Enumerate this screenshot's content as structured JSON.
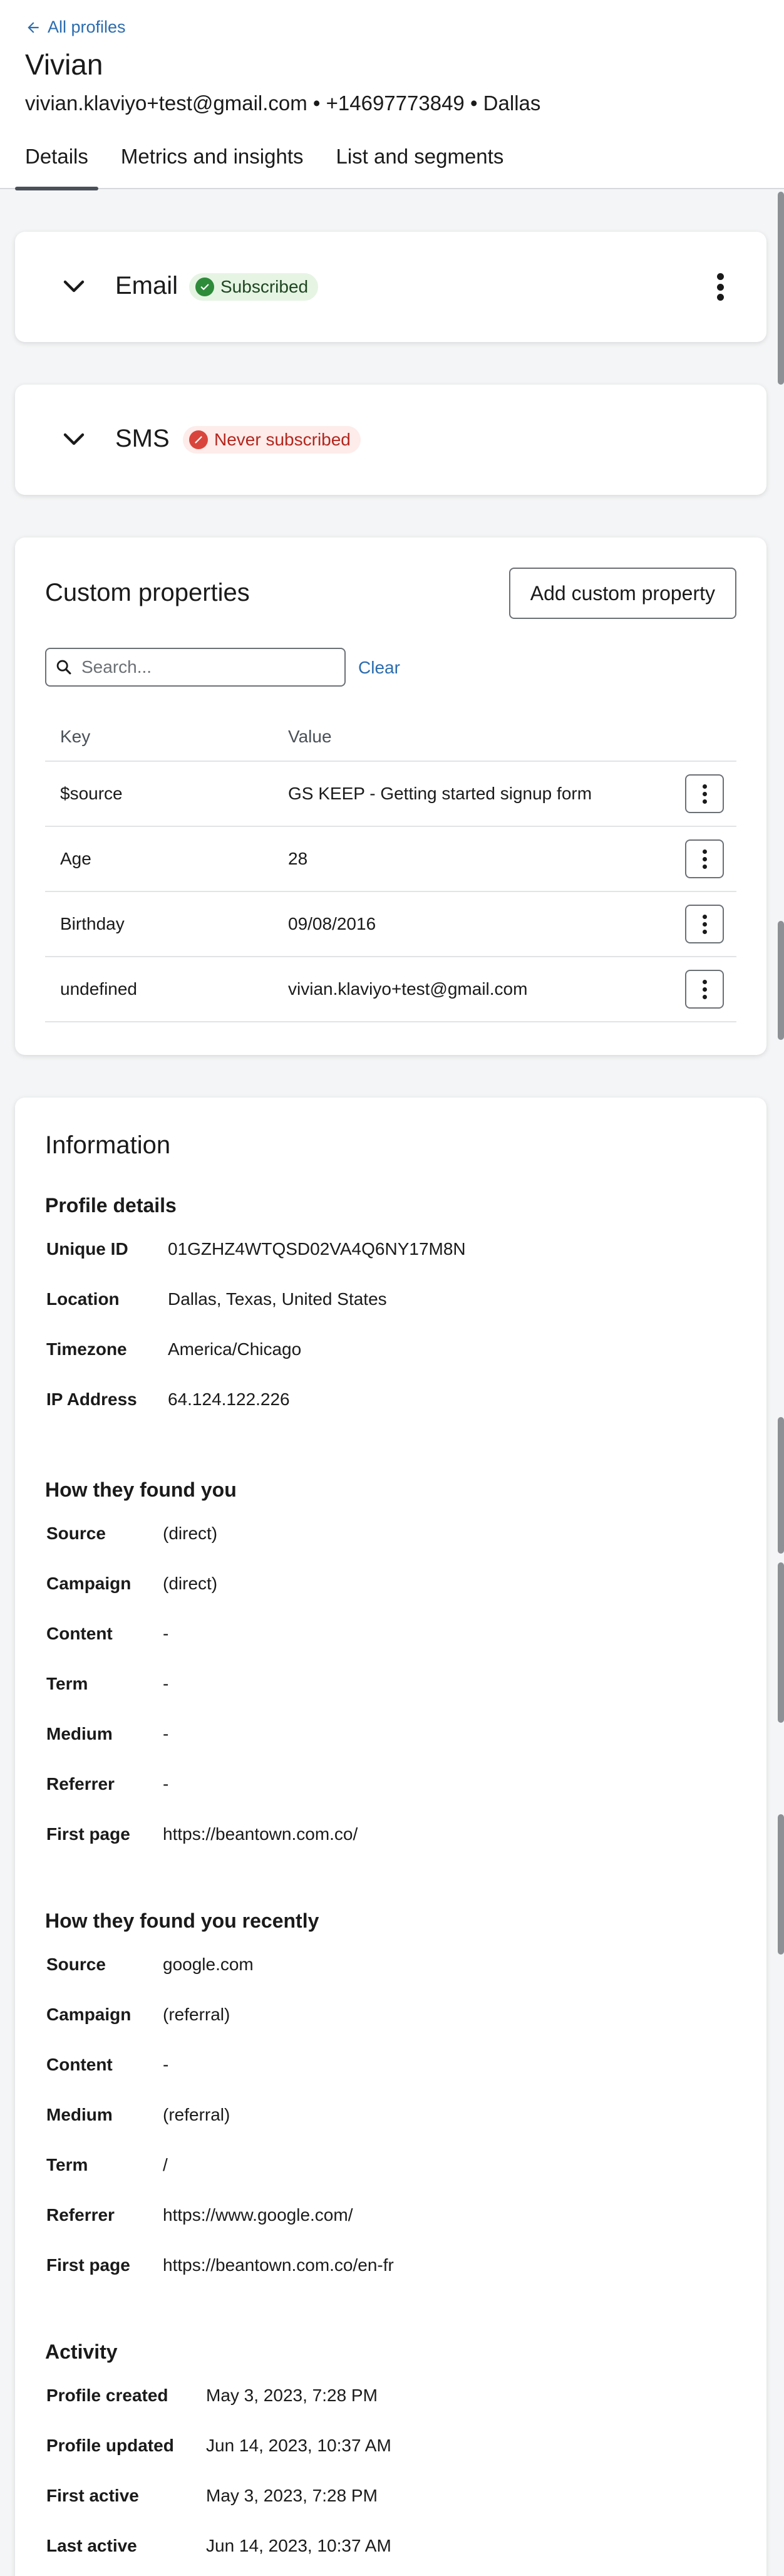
{
  "header": {
    "back_label": "All profiles",
    "name": "Vivian",
    "meta": "vivian.klaviyo+test@gmail.com • +14697773849 • Dallas",
    "tabs": [
      {
        "label": "Details",
        "active": true
      },
      {
        "label": "Metrics and insights",
        "active": false
      },
      {
        "label": "List and segments",
        "active": false
      }
    ]
  },
  "email_card": {
    "title": "Email",
    "status": "Subscribed",
    "status_color": "#2e8b3a"
  },
  "sms_card": {
    "title": "SMS",
    "status": "Never subscribed",
    "status_color": "#d9453c"
  },
  "custom_properties": {
    "title": "Custom properties",
    "add_button": "Add custom property",
    "search_placeholder": "Search...",
    "clear_label": "Clear",
    "columns": {
      "key": "Key",
      "value": "Value"
    },
    "rows": [
      {
        "key": "$source",
        "value": "GS KEEP - Getting started signup form"
      },
      {
        "key": "Age",
        "value": "28"
      },
      {
        "key": "Birthday",
        "value": "09/08/2016"
      },
      {
        "key": "undefined",
        "value": "vivian.klaviyo+test@gmail.com"
      }
    ]
  },
  "information": {
    "title": "Information",
    "profile_details": {
      "heading": "Profile details",
      "items": [
        {
          "label": "Unique ID",
          "value": "01GZHZ4WTQSD02VA4Q6NY17M8N"
        },
        {
          "label": "Location",
          "value": "Dallas, Texas, United States"
        },
        {
          "label": "Timezone",
          "value": "America/Chicago"
        },
        {
          "label": "IP Address",
          "value": "64.124.122.226"
        }
      ]
    },
    "found_you": {
      "heading": "How they found you",
      "items": [
        {
          "label": "Source",
          "value": "(direct)"
        },
        {
          "label": "Campaign",
          "value": "(direct)"
        },
        {
          "label": "Content",
          "value": "-"
        },
        {
          "label": "Term",
          "value": "-"
        },
        {
          "label": "Medium",
          "value": "-"
        },
        {
          "label": "Referrer",
          "value": "-"
        },
        {
          "label": "First page",
          "value": "https://beantown.com.co/"
        }
      ]
    },
    "found_you_recently": {
      "heading": "How they found you recently",
      "items": [
        {
          "label": "Source",
          "value": "google.com"
        },
        {
          "label": "Campaign",
          "value": "(referral)"
        },
        {
          "label": "Content",
          "value": "-"
        },
        {
          "label": "Medium",
          "value": "(referral)"
        },
        {
          "label": "Term",
          "value": "/"
        },
        {
          "label": "Referrer",
          "value": "https://www.google.com/"
        },
        {
          "label": "First page",
          "value": "https://beantown.com.co/en-fr"
        }
      ]
    },
    "activity": {
      "heading": "Activity",
      "items": [
        {
          "label": "Profile created",
          "value": "May 3, 2023, 7:28 PM"
        },
        {
          "label": "Profile updated",
          "value": "Jun 14, 2023, 10:37 AM"
        },
        {
          "label": "First active",
          "value": "May 3, 2023, 7:28 PM"
        },
        {
          "label": "Last active",
          "value": "Jun 14, 2023, 10:37 AM"
        }
      ]
    }
  }
}
